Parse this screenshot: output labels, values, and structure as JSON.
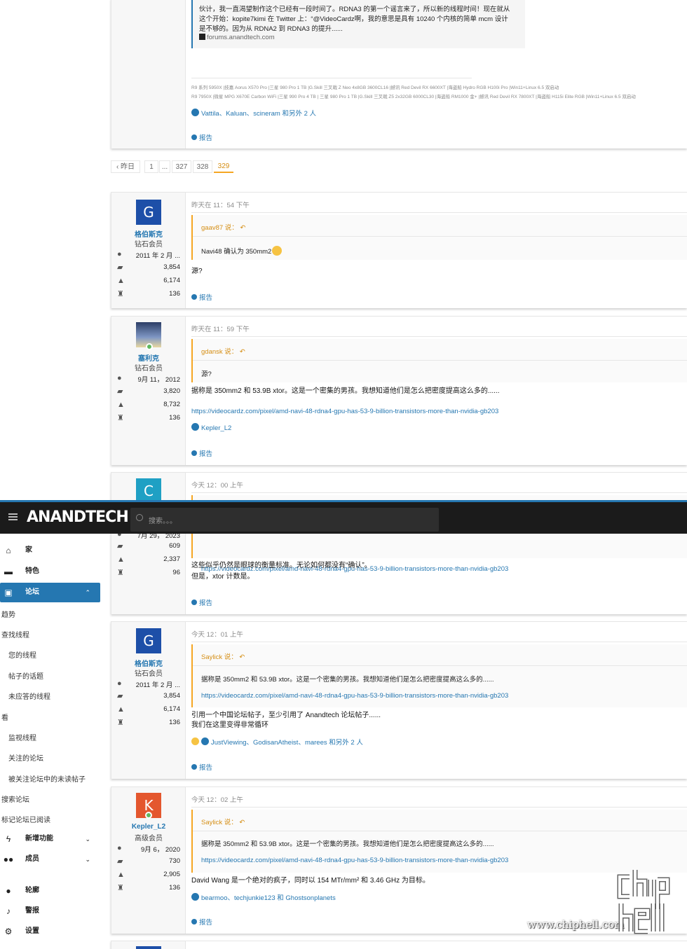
{
  "top_quote": {
    "line1": "伙计，我一直渴望制作这个已经有一段时间了。RDNA3 的第一个谣言来了，所以新的线程时间！现在就从",
    "line2": "这个开始：kopite7kimi 在 Twitter 上：“@VideoCardz啊，我的意思是具有 10240 个内核的简单 mcm 设计",
    "line3": "是不够的。因为从 RDNA2 到 RDNA3 的提升......",
    "source": "forums.anandtech.com"
  },
  "signature": {
    "line1": "R9 系列 5950X |技嘉 Aorus X570 Pro |三星 980 Pro 1 TB |G.Skill 三叉戟 Z Neo 4x8GB 3600CL16 |撼讯 Red Devil RX 6600XT |海盗船 Hydro RGB H100i Pro |Win11+Linux 6.5 双启动",
    "line2": "R9 7950X |微星 MPG X670E Carbon WiFi |三星 990 Pro 4 TB | 三星 980 Pro 1 TB |G.Skill 三叉戟 Z5 2x32GB 6000CL30 |海盗船 RM1000 金+ |撼讯 Red Devil RX 7800XT |海盗船 H115i Elite RGB |Win11+Linux 6.5 双启动"
  },
  "top_reactions": "Vattila、Kaluan、scineram 和另外 2 人",
  "report_label": "报告",
  "pagination": {
    "prev": "‹ 昨日",
    "pages": [
      "1",
      "...",
      "327",
      "328",
      "329"
    ],
    "active": "329"
  },
  "posts": [
    {
      "avatar_letter": "G",
      "avatar_color": "#1d4fa8",
      "username": "格伯斯克",
      "rank": "钻石会员",
      "joined": "2011 年 2 月 ...",
      "messages": "3,854",
      "reactions": "6,174",
      "points": "136",
      "time": "昨天在 11：54 下午",
      "quote_author": "gaav87 说：",
      "quote_text": "Navi48 确认为 350mm2",
      "body": [
        "源?"
      ]
    },
    {
      "avatar_letter": "",
      "avatar_color": "#6b7fa3",
      "username": "塞利克",
      "rank": "钻石会员",
      "joined": "9月 11， 2012",
      "messages": "3,820",
      "reactions": "8,732",
      "points": "136",
      "time": "昨天在 11：59 下午",
      "quote_author": "gdansk 说：",
      "quote_text": "源?",
      "body": [
        "据称是 350mm2 和 53.9B xtor。这是一个密集的男孩。我想知道他们是怎么把密度提高这么多的......"
      ],
      "link": "https://videocardz.com/pixel/amd-navi-48-rdna4-gpu-has-53-9-billion-transistors-more-than-nvidia-gb203",
      "reactions_line": "Kepler_L2"
    },
    {
      "avatar_letter": "C",
      "avatar_color": "#1fa0c4",
      "time": "今天 12：00 上午",
      "joined": "7月 29， 2023",
      "messages": "609",
      "reactions": "2,337",
      "points": "96",
      "quote_link": "https://videocardz.com/pixel/amd-navi-48-rdna4-gpu-has-53-9-billion-transistors-more-than-nvidia-gb203",
      "body": [
        "这些似乎仍然是眼球的衡量标准。无论如何都没有“确认”。",
        "但是，xtor 计数是。"
      ]
    },
    {
      "avatar_letter": "G",
      "avatar_color": "#1d4fa8",
      "username": "格伯斯克",
      "rank": "钻石会员",
      "joined": "2011 年 2 月 ...",
      "messages": "3,854",
      "reactions": "6,174",
      "points": "136",
      "time": "今天 12：01 上午",
      "quote_author": "Saylick 说：",
      "quote_text": "据称是 350mm2 和 53.9B xtor。这是一个密集的男孩。我想知道他们是怎么把密度提高这么多的......",
      "quote_link": "https://videocardz.com/pixel/amd-navi-48-rdna4-gpu-has-53-9-billion-transistors-more-than-nvidia-gb203",
      "body": [
        "引用一个中国论坛帖子，至少引用了 Anandtech 论坛帖子......",
        "我们在这里变得非常循环"
      ],
      "reactions_line": "JustViewing、GodisanAtheist、marees 和另外 2 人"
    },
    {
      "avatar_letter": "K",
      "avatar_color": "#e4572e",
      "username": "Kepler_L2",
      "rank": "高级会员",
      "joined": "9月 6， 2020",
      "messages": "730",
      "reactions": "2,905",
      "points": "136",
      "time": "今天 12：02 上午",
      "quote_author": "Saylick 说：",
      "quote_text": "据称是 350mm2 和 53.9B xtor。这是一个密集的男孩。我想知道他们是怎么把密度提高这么多的......",
      "quote_link": "https://videocardz.com/pixel/amd-navi-48-rdna4-gpu-has-53-9-billion-transistors-more-than-nvidia-gb203",
      "body": [
        "David Wang 是一个绝对的疯子，同时以 154 MTr/mm² 和 3.46 GHz 为目标。"
      ],
      "reactions_line": "bearmoo、techjunkie123 和 Ghostsonplanets"
    }
  ],
  "header": {
    "logo": "ANANDTECH",
    "search_placeholder": "搜索。。。"
  },
  "sidebar": {
    "home": "家",
    "featured": "特色",
    "forums": "论坛",
    "subs": [
      "趋势",
      "查找线程",
      "您的线程",
      "帖子的话题",
      "未应答的线程",
      "看",
      "监视线程",
      "关注的论坛",
      "被关注论坛中的未读帖子",
      "搜索论坛",
      "标记论坛已阅读"
    ],
    "whats_new": "新增功能",
    "members": "成员",
    "account": "轮廓",
    "alerts": "警报",
    "settings": "设置"
  },
  "watermark": {
    "url": "www.chiphell.com",
    "logo": "chip hell"
  }
}
